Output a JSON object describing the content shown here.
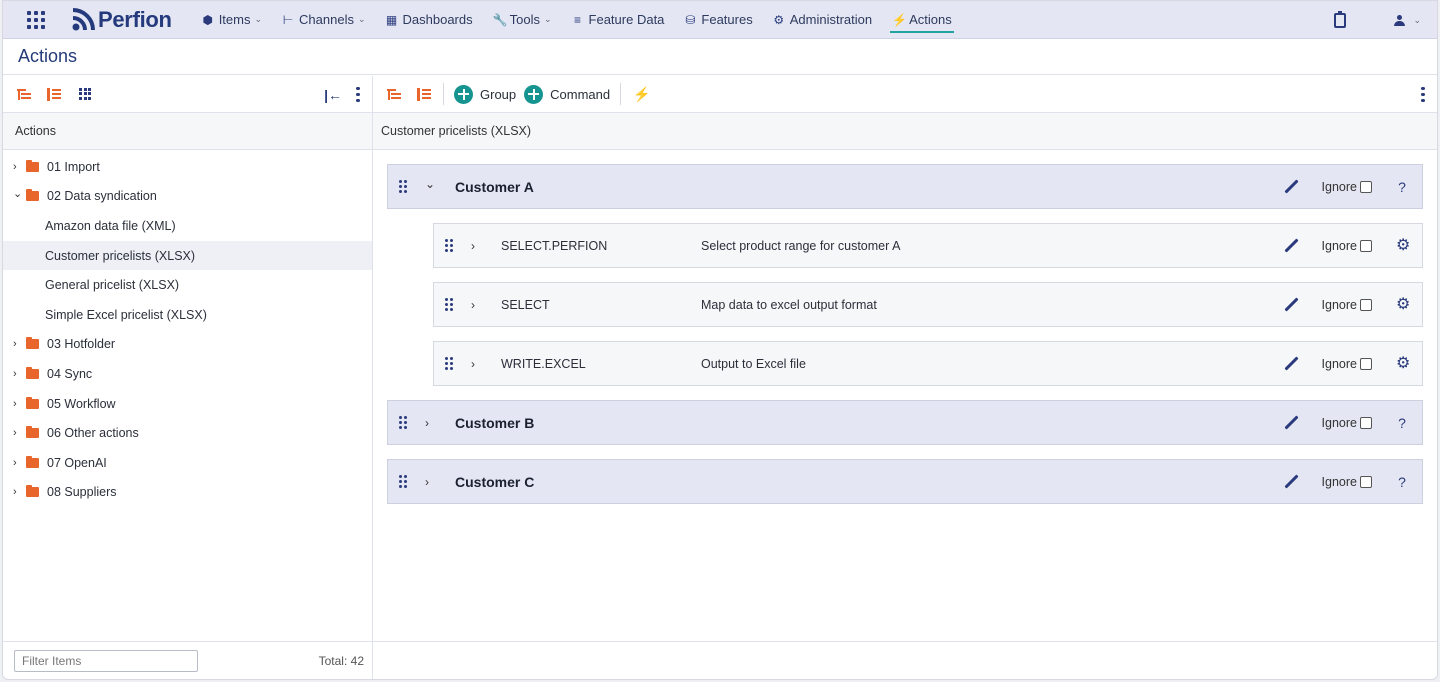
{
  "nav": {
    "brand": "Perfion",
    "items": [
      {
        "label": "Items",
        "icon": "cube-icon",
        "caret": true
      },
      {
        "label": "Channels",
        "icon": "channels-icon",
        "caret": true
      },
      {
        "label": "Dashboards",
        "icon": "dashboard-icon",
        "caret": false
      },
      {
        "label": "Tools",
        "icon": "wrench-icon",
        "caret": true
      },
      {
        "label": "Feature Data",
        "icon": "list-icon",
        "caret": false
      },
      {
        "label": "Features",
        "icon": "database-icon",
        "caret": false
      },
      {
        "label": "Administration",
        "icon": "gear-icon",
        "caret": false
      },
      {
        "label": "Actions",
        "icon": "actions-icon",
        "caret": false
      }
    ],
    "active": "Actions",
    "accent": "#20a4a0"
  },
  "page": {
    "title": "Actions"
  },
  "left": {
    "header": "Actions",
    "tree": [
      {
        "label": "01 Import",
        "type": "folder",
        "expanded": false
      },
      {
        "label": "02 Data syndication",
        "type": "folder",
        "expanded": true
      },
      {
        "label": "Amazon data file (XML)",
        "type": "leaf"
      },
      {
        "label": "Customer pricelists (XLSX)",
        "type": "leaf",
        "selected": true
      },
      {
        "label": "General pricelist (XLSX)",
        "type": "leaf"
      },
      {
        "label": "Simple Excel pricelist (XLSX)",
        "type": "leaf"
      },
      {
        "label": "03 Hotfolder",
        "type": "folder",
        "expanded": false
      },
      {
        "label": "04 Sync",
        "type": "folder",
        "expanded": false
      },
      {
        "label": "05 Workflow",
        "type": "folder",
        "expanded": false
      },
      {
        "label": "06 Other actions",
        "type": "folder",
        "expanded": false
      },
      {
        "label": "07 OpenAI",
        "type": "folder",
        "expanded": false
      },
      {
        "label": "08 Suppliers",
        "type": "folder",
        "expanded": false
      }
    ],
    "filter_placeholder": "Filter Items",
    "total": "Total: 42"
  },
  "right": {
    "toolbar": {
      "group_label": "Group",
      "command_label": "Command"
    },
    "header": "Customer pricelists (XLSX)",
    "ignore_label": "Ignore",
    "rows": [
      {
        "kind": "group",
        "name": "Customer A",
        "expanded": true
      },
      {
        "kind": "command",
        "name": "SELECT.PERFION",
        "desc": "Select product range for customer A"
      },
      {
        "kind": "command",
        "name": "SELECT",
        "desc": "Map data to excel output format"
      },
      {
        "kind": "command",
        "name": "WRITE.EXCEL",
        "desc": "Output to Excel file"
      },
      {
        "kind": "group",
        "name": "Customer B",
        "expanded": false
      },
      {
        "kind": "group",
        "name": "Customer C",
        "expanded": false
      }
    ]
  },
  "colors": {
    "brand_navy": "#243a7d",
    "folder_orange": "#e8652b",
    "add_teal": "#16948f"
  }
}
